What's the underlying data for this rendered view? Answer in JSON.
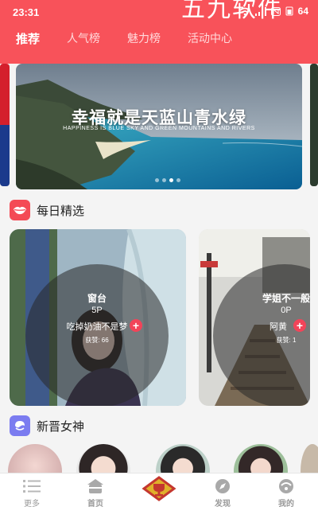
{
  "status": {
    "time": "23:31",
    "battery": "64"
  },
  "header": {
    "brand": "五九软件"
  },
  "tabs": [
    {
      "label": "推荐",
      "active": true
    },
    {
      "label": "人气榜"
    },
    {
      "label": "魅力榜"
    },
    {
      "label": "活动中心"
    }
  ],
  "banner": {
    "title": "幸福就是天蓝山青水绿",
    "subtitle": "HAPPINESS IS BLUE SKY AND GREEN MOUNTAINS AND RIVERS"
  },
  "daily": {
    "title": "每日精选"
  },
  "cards": [
    {
      "name": "窗台",
      "count": "5P",
      "desc": "吃掉奶油不是梦",
      "likes": "获赞: 66"
    },
    {
      "name": "学姐不一般",
      "count": "0P",
      "desc": "阿黄",
      "likes": "获赞: 1"
    }
  ],
  "newcomers": {
    "title": "新晋女神"
  },
  "nav": [
    {
      "label": "更多",
      "icon": "list-icon"
    },
    {
      "label": "首页",
      "icon": "home-icon"
    },
    {
      "label": "",
      "icon": "trophy-icon"
    },
    {
      "label": "发现",
      "icon": "compass-icon"
    },
    {
      "label": "我的",
      "icon": "profile-icon"
    }
  ],
  "colors": {
    "primary": "#f8525a",
    "accent": "#f24459"
  }
}
